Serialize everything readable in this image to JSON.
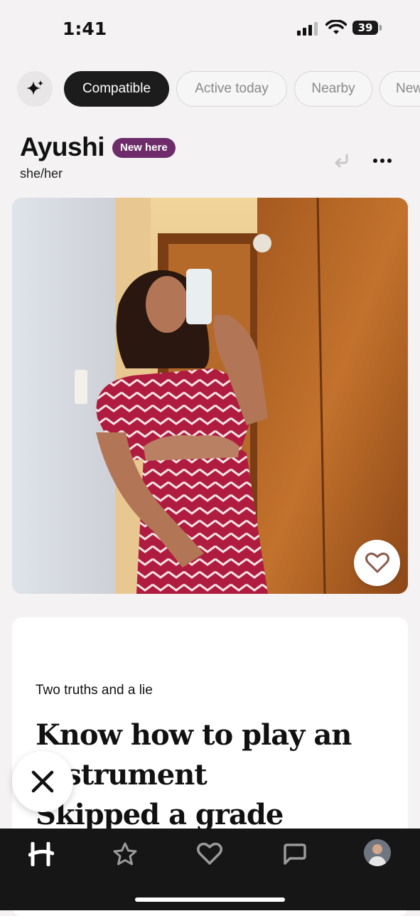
{
  "status": {
    "time": "1:41",
    "battery": "39"
  },
  "filters": {
    "sparkle_icon": "sparkle-icon",
    "chips": [
      "Compatible",
      "Active today",
      "Nearby",
      "New"
    ]
  },
  "profile": {
    "name": "Ayushi",
    "badge": "New here",
    "pronouns": "she/her"
  },
  "prompt": {
    "question": "Two truths and a lie",
    "answer_lines": [
      "Know how to play an",
      "instrument",
      "Skipped a grade"
    ]
  },
  "colors": {
    "accent": "#6e2c6a",
    "dark": "#1c1c1c",
    "tabbar": "#161616"
  },
  "tabbar": {
    "items": [
      "hinge-logo-icon",
      "star-icon",
      "heart-icon",
      "chat-icon",
      "profile-avatar"
    ]
  }
}
